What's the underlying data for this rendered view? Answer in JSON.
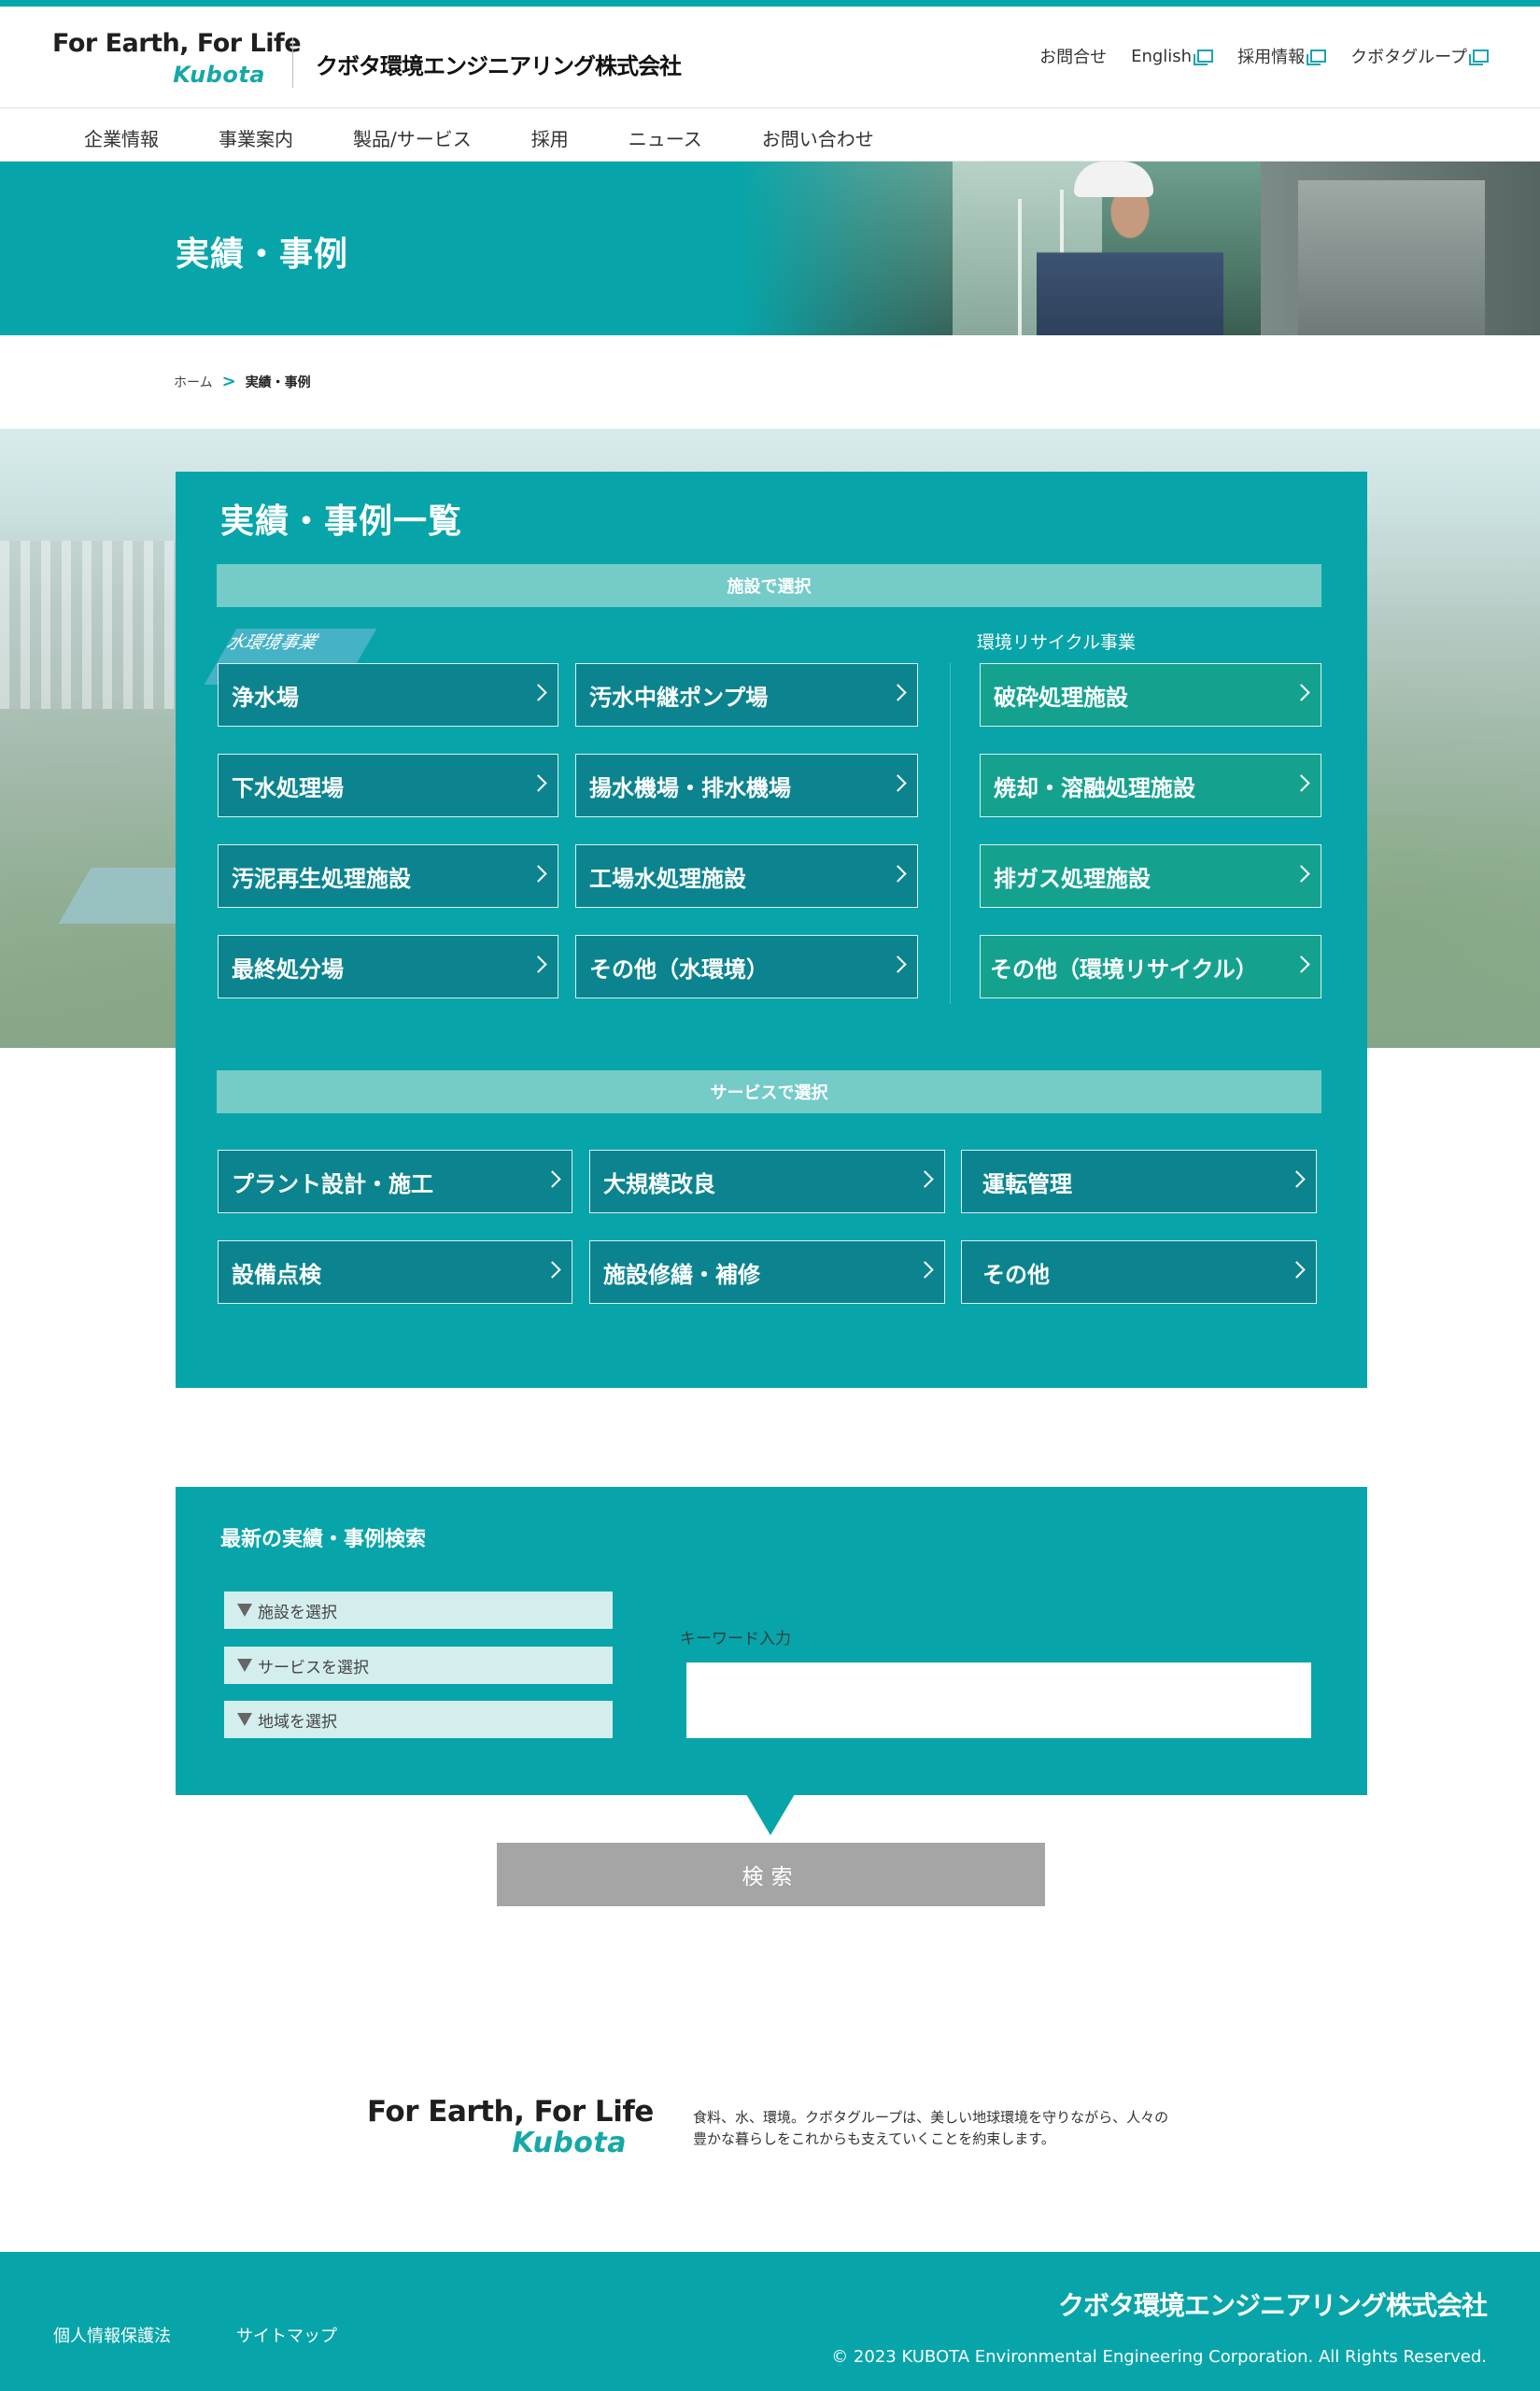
{
  "header": {
    "slogan": "For Earth, For Life",
    "brand": "Kubota",
    "company": "クボタ環境エンジニアリング株式会社",
    "util_nav": [
      {
        "label": "お問合せ",
        "external": false
      },
      {
        "label": "English",
        "external": true
      },
      {
        "label": "採用情報",
        "external": true
      },
      {
        "label": "クボタグループ",
        "external": true
      }
    ]
  },
  "gnav": [
    "企業情報",
    "事業案内",
    "製品/サービス",
    "採用",
    "ニュース",
    "お問い合わせ"
  ],
  "hero": {
    "title": "実績・事例"
  },
  "breadcrumb": {
    "home": "ホーム",
    "separator": ">",
    "current": "実績・事例"
  },
  "panel": {
    "title": "実績・事例一覧",
    "facility_bar": "施設で選択",
    "water_label": "水環境事業",
    "recycle_label": "環境リサイクル事業",
    "water_buttons": [
      "浄水場",
      "汚水中継ポンプ場",
      "下水処理場",
      "揚水機場・排水機場",
      "汚泥再生処理施設",
      "工場水処理施設",
      "最終処分場",
      "その他（水環境）"
    ],
    "recycle_buttons": [
      "破砕処理施設",
      "焼却・溶融処理施設",
      "排ガス処理施設",
      "その他（環境リサイクル）"
    ],
    "service_bar": "サービスで選択",
    "service_buttons": [
      "プラント設計・施工",
      "大規模改良",
      "運転管理",
      "設備点検",
      "施設修繕・補修",
      "その他"
    ]
  },
  "search": {
    "title": "最新の実績・事例検索",
    "selects": [
      "施設を選択",
      "サービスを選択",
      "地域を選択"
    ],
    "keyword_label": "キーワード入力",
    "keyword_value": "",
    "button": "検索"
  },
  "footer": {
    "slogan": "For Earth, For Life",
    "brand": "Kubota",
    "description": "食料、水、環境。クボタグループは、美しい地球環境を守りながら、人々の豊かな暮らしをこれからも支えていくことを約束します。",
    "links": [
      "個人情報保護法",
      "サイトマップ"
    ],
    "company": "クボタ環境エンジニアリング株式会社",
    "copyright": "© 2023 KUBOTA Environmental Engineering Corporation. All Rights Reserved."
  },
  "colors": {
    "accent": "#07a5a9",
    "water_button": "#0b848f",
    "recycle_button": "#14a28e",
    "section_bar": "#74cbc8",
    "search_button": "#a5a5a5"
  }
}
